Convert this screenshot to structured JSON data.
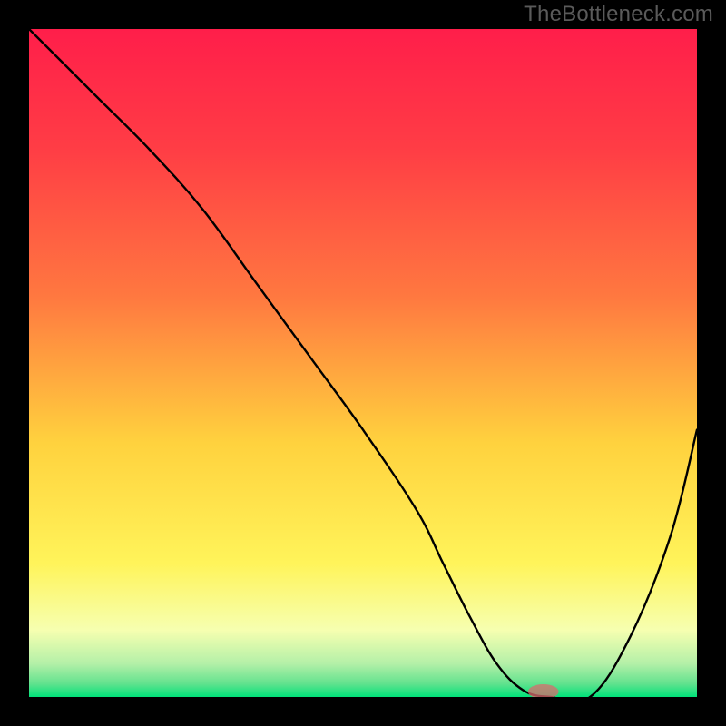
{
  "watermark": "TheBottleneck.com",
  "colors": {
    "top": "#ff1e4a",
    "mid_upper": "#ff7840",
    "mid": "#ffd23e",
    "mid_lower": "#fff45a",
    "lower": "#f6ffb0",
    "bottom_light": "#b4f0a8",
    "bottom": "#00e27a",
    "frame_bg": "#000000",
    "curve": "#000000",
    "marker": "#d96b6e"
  },
  "chart_data": {
    "type": "line",
    "title": "",
    "xlabel": "",
    "ylabel": "",
    "xlim": [
      0,
      100
    ],
    "ylim": [
      0,
      100
    ],
    "series": [
      {
        "name": "bottleneck-curve",
        "x": [
          0,
          10,
          18,
          26,
          34,
          42,
          50,
          58,
          62,
          66,
          70,
          74,
          78,
          84,
          90,
          96,
          100
        ],
        "y": [
          100,
          90,
          82,
          73,
          62,
          51,
          40,
          28,
          20,
          12,
          5,
          1,
          0,
          0,
          9,
          24,
          40
        ]
      }
    ],
    "marker": {
      "x": 77,
      "y": 0.8,
      "rx": 2.3,
      "ry": 1.1
    }
  }
}
